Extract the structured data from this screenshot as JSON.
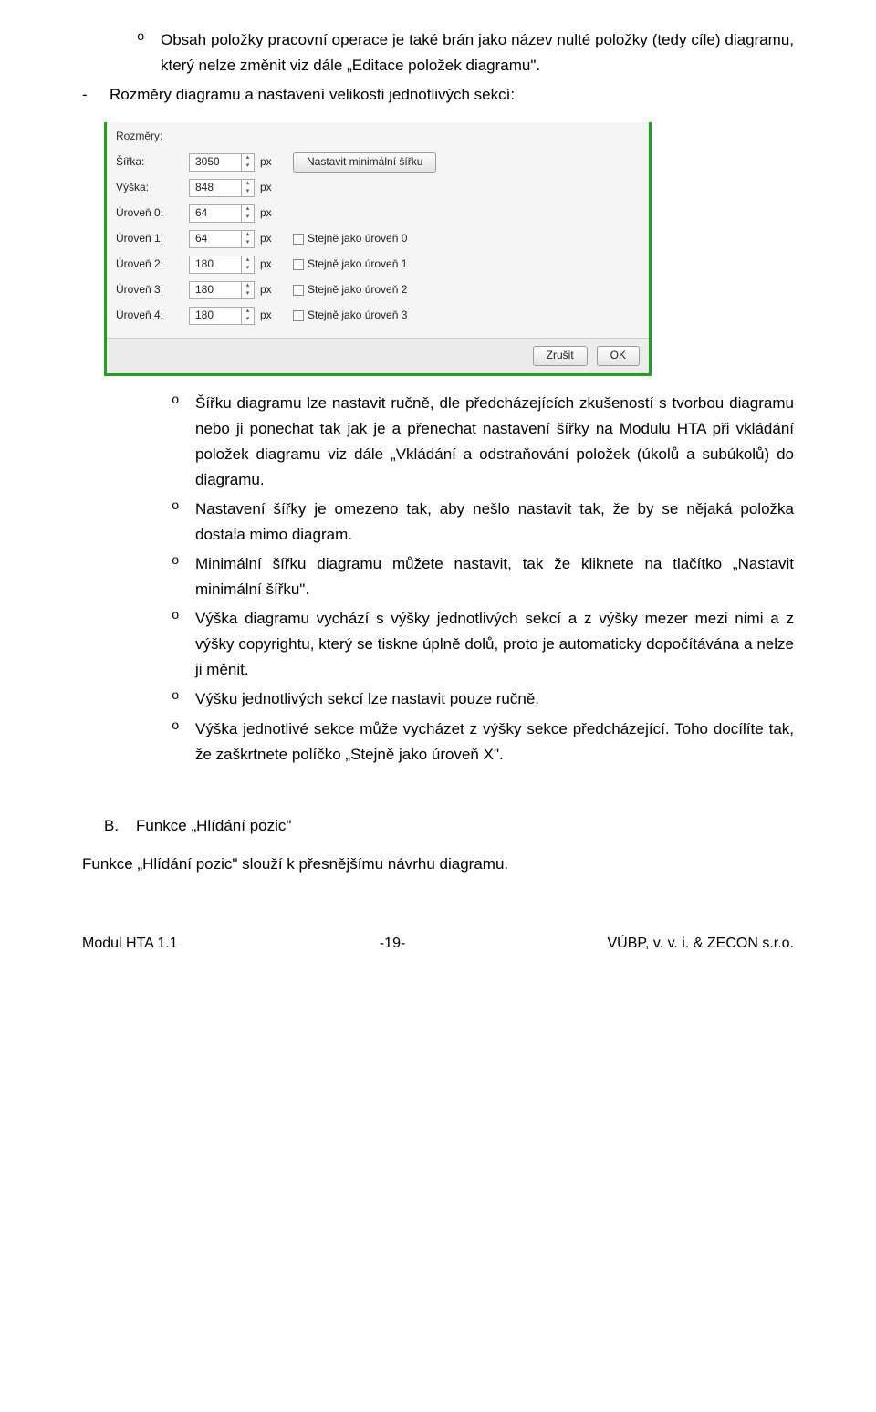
{
  "intro": {
    "bullet0_text": "Obsah položky pracovní operace je také brán jako název nulté položky (tedy cíle) diagramu, který nelze změnit viz dále „Editace položek diagramu\".",
    "bullet1_text": "Rozměry diagramu a nastavení velikosti jednotlivých sekcí:"
  },
  "dialog": {
    "group_label": "Rozměry:",
    "rows": [
      {
        "label": "Šířka:",
        "value": "3050",
        "unit": "px",
        "button": "Nastavit minimální šířku"
      },
      {
        "label": "Výška:",
        "value": "848",
        "unit": "px"
      },
      {
        "label": "Úroveň 0:",
        "value": "64",
        "unit": "px"
      },
      {
        "label": "Úroveň 1:",
        "value": "64",
        "unit": "px",
        "chk": "Stejně jako úroveň 0"
      },
      {
        "label": "Úroveň 2:",
        "value": "180",
        "unit": "px",
        "chk": "Stejně jako úroveň 1"
      },
      {
        "label": "Úroveň 3:",
        "value": "180",
        "unit": "px",
        "chk": "Stejně jako úroveň 2"
      },
      {
        "label": "Úroveň 4:",
        "value": "180",
        "unit": "px",
        "chk": "Stejně jako úroveň 3"
      }
    ],
    "cancel": "Zrušit",
    "ok": "OK"
  },
  "body_bullets": [
    "Šířku diagramu lze nastavit ručně, dle předcházejících zkušeností s tvorbou diagramu nebo ji ponechat tak jak je a přenechat nastavení šířky na Modulu HTA při vkládání položek diagramu viz dále „Vkládání a odstraňování položek (úkolů a subúkolů) do diagramu.",
    "Nastavení šířky je omezeno tak, aby nešlo nastavit tak, že by se nějaká položka dostala mimo diagram.",
    "Minimální šířku diagramu můžete nastavit, tak že kliknete na tlačítko „Nastavit minimální šířku\".",
    "Výška diagramu vychází s výšky jednotlivých sekcí a z výšky mezer mezi nimi a z výšky copyrightu, který se tiskne úplně dolů, proto je automaticky dopočítávána a nelze ji měnit.",
    "Výšku jednotlivých sekcí lze nastavit pouze ručně.",
    "Výška jednotlivé sekce může vycházet z výšky sekce předcházející. Toho docílíte tak, že zaškrtnete políčko „Stejně jako úroveň X\"."
  ],
  "section": {
    "letter": "B.",
    "title": "Funkce „Hlídání pozic\""
  },
  "para_after": "Funkce „Hlídání pozic\" slouží k přesnějšímu návrhu diagramu.",
  "footer": {
    "left": "Modul HTA 1.1",
    "center": "-19-",
    "right": "VÚBP, v. v. i. & ZECON s.r.o."
  }
}
